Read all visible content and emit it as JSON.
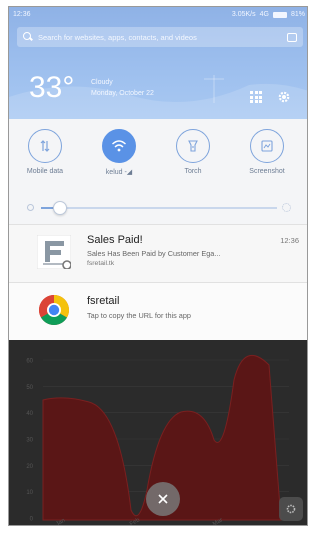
{
  "status_bar": {
    "time": "12:36",
    "net_speed": "3.05K/s",
    "network": "4G",
    "battery": "81%"
  },
  "search": {
    "placeholder": "Search for websites, apps, contacts, and videos"
  },
  "weather": {
    "temperature": "33°",
    "condition": "Cloudy",
    "date": "Monday, October 22"
  },
  "quick_settings": [
    {
      "label": "Mobile data",
      "icon": "mobile-data-icon",
      "active": false
    },
    {
      "label": "kelud -◢",
      "icon": "wifi-icon",
      "active": true
    },
    {
      "label": "Torch",
      "icon": "torch-icon",
      "active": false
    },
    {
      "label": "Screenshot",
      "icon": "screenshot-icon",
      "active": false
    }
  ],
  "brightness": {
    "level": 0.05
  },
  "notifications": [
    {
      "title": "Sales Paid!",
      "time": "12:36",
      "body": "Sales Has Been Paid by Customer Ega...",
      "source": "fsretail.tk",
      "icon": "fsretail-app-icon"
    },
    {
      "title": "fsretail",
      "body": "Tap to copy the URL for this app",
      "icon": "chrome-icon"
    }
  ],
  "background_chart": {
    "fill_color": "#5a1616",
    "y_ticks": [
      "60",
      "50",
      "40",
      "30",
      "20",
      "10",
      "0"
    ],
    "x_ticks": [
      "Jan",
      "Feb",
      "Mar"
    ]
  },
  "colors": {
    "accent": "#5a92e6",
    "header": "#9dbfee"
  }
}
